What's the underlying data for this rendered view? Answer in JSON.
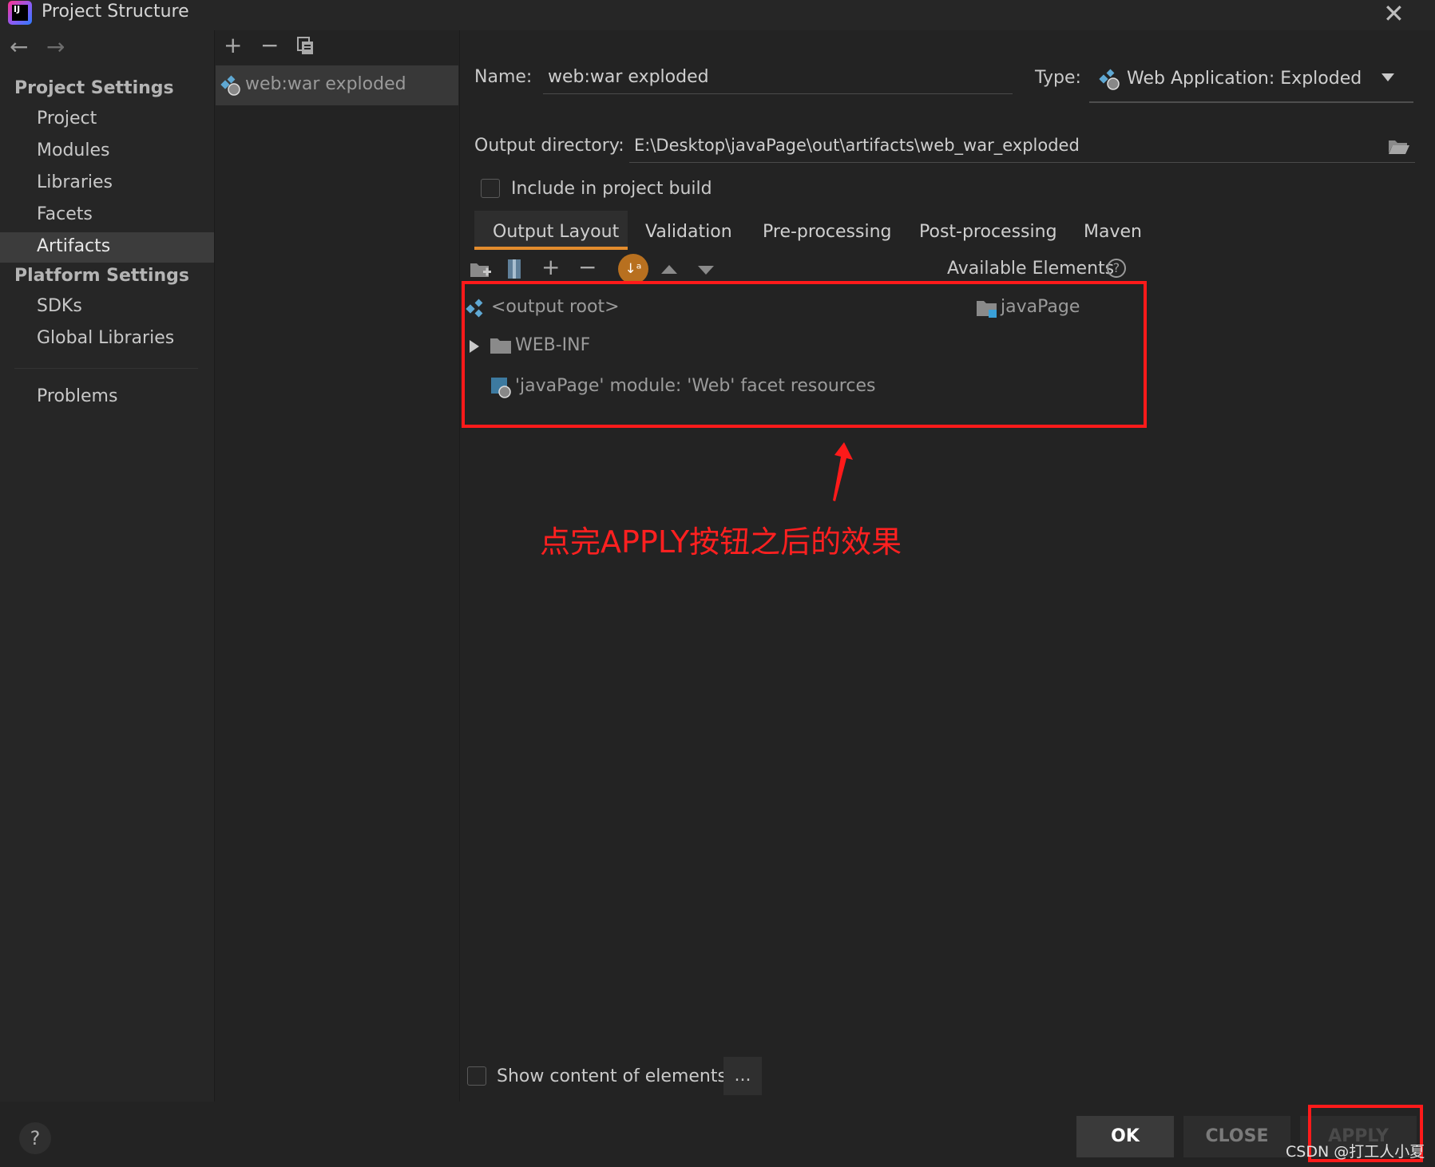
{
  "window": {
    "title": "Project Structure"
  },
  "nav": {
    "back": "←",
    "forward": "→",
    "project_settings": "Project Settings",
    "project_items": [
      "Project",
      "Modules",
      "Libraries",
      "Facets",
      "Artifacts"
    ],
    "platform_settings": "Platform Settings",
    "platform_items": [
      "SDKs",
      "Global Libraries"
    ],
    "problems": "Problems",
    "selected": "Artifacts"
  },
  "artifacts": {
    "toolbar": {
      "add": "+",
      "remove": "−",
      "copy": "copy-icon"
    },
    "items": [
      "web:war exploded"
    ]
  },
  "form": {
    "name_label": "Name:",
    "name_value": "web:war exploded",
    "type_label": "Type:",
    "type_value": "Web Application: Exploded",
    "output_dir_label": "Output directory:",
    "output_dir_value": "E:\\Desktop\\javaPage\\out\\artifacts\\web_war_exploded",
    "include_build_label": "Include in project build",
    "include_build_checked": false
  },
  "tabs": [
    "Output Layout",
    "Validation",
    "Pre-processing",
    "Post-processing",
    "Maven"
  ],
  "active_tab": "Output Layout",
  "layout": {
    "available_elements": "Available Elements",
    "tree": {
      "root": "<output root>",
      "web_inf": "WEB-INF",
      "facet_resources": "'javaPage' module: 'Web' facet resources"
    },
    "available_items": [
      "javaPage"
    ]
  },
  "annotation": "点完APPLY按钮之后的效果",
  "footer": {
    "show_content_label": "Show content of elements",
    "dots": "...",
    "ok": "OK",
    "close": "CLOSE",
    "apply": "APPLY",
    "help": "?",
    "watermark": "CSDN @打工人小夏"
  },
  "colors": {
    "accent": "#e38c2d",
    "highlight_red": "#ff1a1a",
    "background": "#232323"
  }
}
